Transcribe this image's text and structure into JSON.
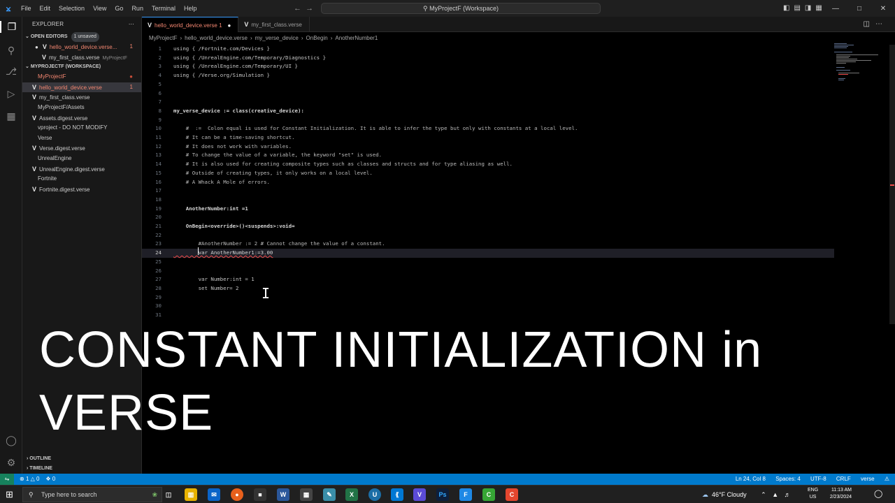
{
  "menu": [
    "File",
    "Edit",
    "Selection",
    "View",
    "Go",
    "Run",
    "Terminal",
    "Help"
  ],
  "command_center": "MyProjectF (Workspace)",
  "sidebar": {
    "title": "EXPLORER",
    "open_editors_label": "OPEN EDITORS",
    "unsaved_badge": "1 unsaved",
    "open_editors": [
      {
        "name": "hello_world_device.verse...",
        "count": "1"
      },
      {
        "name": "my_first_class.verse",
        "folder": "MyProjectF"
      }
    ],
    "workspace_label": "MYPROJECTF (WORKSPACE)",
    "tree": [
      {
        "name": "MyProjectF",
        "error": true,
        "dot": true
      },
      {
        "name": "hello_world_device.verse",
        "error": true,
        "count": "1",
        "verse": true,
        "active": true
      },
      {
        "name": "my_first_class.verse",
        "verse": true
      },
      {
        "name": "MyProjectF/Assets"
      },
      {
        "name": "Assets.digest.verse",
        "verse": true
      },
      {
        "name": "vproject - DO NOT MODIFY"
      },
      {
        "name": "Verse"
      },
      {
        "name": "Verse.digest.verse",
        "verse": true
      },
      {
        "name": "UnrealEngine"
      },
      {
        "name": "UnrealEngine.digest.verse",
        "verse": true
      },
      {
        "name": "Fortnite"
      },
      {
        "name": "Fortnite.digest.verse",
        "verse": true
      }
    ],
    "outline_label": "OUTLINE",
    "timeline_label": "TIMELINE"
  },
  "tabs": [
    {
      "label": "hello_world_device.verse 1",
      "active": true
    },
    {
      "label": "my_first_class.verse",
      "active": false
    }
  ],
  "breadcrumbs": [
    "MyProjectF",
    "hello_world_device.verse",
    "my_verse_device",
    "OnBegin",
    "AnotherNumber1"
  ],
  "code_lines": [
    {
      "n": "1",
      "t": "using { /Fortnite.com/Devices }",
      "k": "using"
    },
    {
      "n": "2",
      "t": "using { /UnrealEngine.com/Temporary/Diagnostics }",
      "k": "using"
    },
    {
      "n": "3",
      "t": "using { /UnrealEngine.com/Temporary/UI }",
      "k": "using"
    },
    {
      "n": "4",
      "t": "using { /Verse.org/Simulation }",
      "k": "using"
    },
    {
      "n": "5",
      "t": ""
    },
    {
      "n": "6",
      "t": ""
    },
    {
      "n": "7",
      "t": ""
    },
    {
      "n": "8",
      "t": "my_verse_device := class(creative_device):",
      "k": "def"
    },
    {
      "n": "9",
      "t": ""
    },
    {
      "n": "10",
      "t": "    #  :=  Colon equal is used for Constant Initialization. It is able to infer the type but only with constants at a local level.",
      "k": "cmt"
    },
    {
      "n": "11",
      "t": "    # It can be a time-saving shortcut.",
      "k": "cmt"
    },
    {
      "n": "12",
      "t": "    # It does not work with variables.",
      "k": "cmt"
    },
    {
      "n": "13",
      "t": "    # To change the value of a variable, the keyword \"set\" is used.",
      "k": "cmt"
    },
    {
      "n": "14",
      "t": "    # It is also used for creating composite types such as classes and structs and for type aliasing as well.",
      "k": "cmt"
    },
    {
      "n": "15",
      "t": "    # Outside of creating types, it only works on a local level.",
      "k": "cmt"
    },
    {
      "n": "16",
      "t": "    # A Whack A Mole of errors.",
      "k": "cmt"
    },
    {
      "n": "17",
      "t": ""
    },
    {
      "n": "18",
      "t": ""
    },
    {
      "n": "19",
      "t": "    AnotherNumber:int =1",
      "k": "def"
    },
    {
      "n": "20",
      "t": ""
    },
    {
      "n": "21",
      "t": "    OnBegin<override>()<suspends>:void=",
      "k": "def"
    },
    {
      "n": "22",
      "t": ""
    },
    {
      "n": "23",
      "t": "        #AnotherNumber := 2 # Cannot change the value of a constant.",
      "k": "cmt"
    },
    {
      "n": "24",
      "t": "        var AnotherNumber1:=3.00",
      "k": "err",
      "current": true
    },
    {
      "n": "25",
      "t": ""
    },
    {
      "n": "26",
      "t": ""
    },
    {
      "n": "27",
      "t": "        var Number:int = 1",
      "k": "plain"
    },
    {
      "n": "28",
      "t": "        set Number= 2",
      "k": "plain"
    },
    {
      "n": "29",
      "t": ""
    },
    {
      "n": "30",
      "t": ""
    },
    {
      "n": "31",
      "t": ""
    }
  ],
  "overlay_title_line1": "CONSTANT INITIALIZATION in",
  "overlay_title_line2": "VERSE",
  "status": {
    "errors": "1",
    "warnings": "0",
    "ports": "0",
    "position": "Ln 24, Col 8",
    "spaces": "Spaces: 4",
    "encoding": "UTF-8",
    "eol": "CRLF",
    "language": "verse"
  },
  "taskbar": {
    "search_placeholder": "Type here to search",
    "weather": "46°F  Cloudy",
    "lang_top": "ENG",
    "lang_bottom": "US",
    "time": "11:13 AM",
    "date": "2/23/2024"
  },
  "colors": {
    "accent": "#007acc",
    "error": "#f14c4c",
    "editor_bg": "#000000",
    "sidebar_bg": "#181818"
  }
}
